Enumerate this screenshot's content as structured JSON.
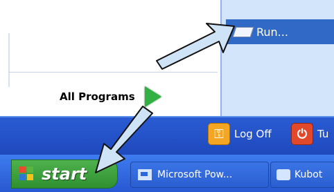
{
  "start_menu": {
    "all_programs_label": "All Programs",
    "run_label": "Run..."
  },
  "bottom_actions": {
    "log_off_label": "Log Off",
    "turn_off_label": "Tu"
  },
  "taskbar": {
    "start_label": "start",
    "buttons": [
      {
        "label": "Microsoft Pow..."
      },
      {
        "label": "Kubot"
      }
    ]
  },
  "annotations": {
    "arrow_color": "#cfe3f6",
    "arrow_outline": "#1a1a1a"
  }
}
